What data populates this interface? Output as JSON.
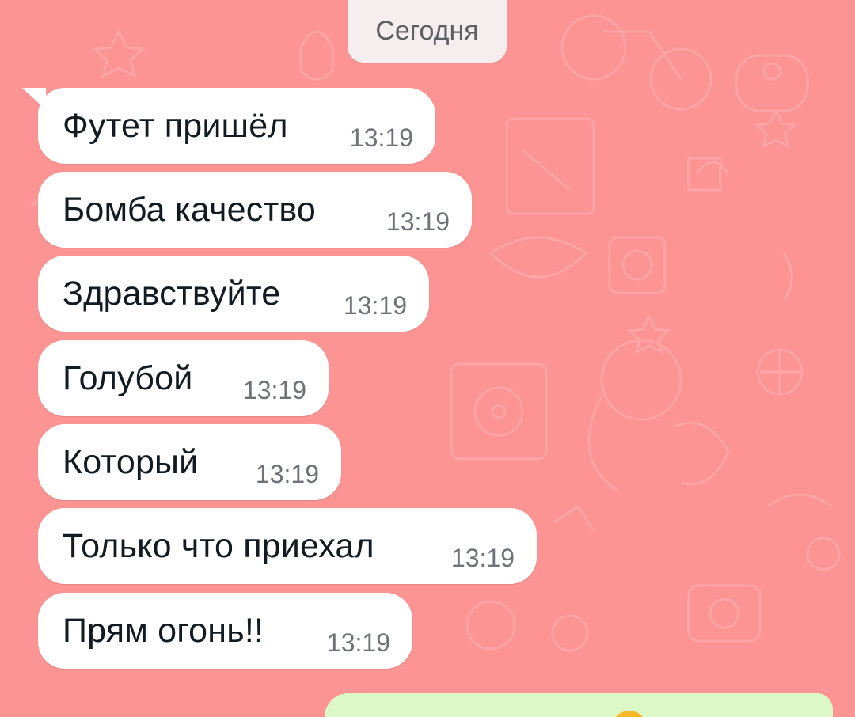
{
  "chat": {
    "date_separator": "Сегодня",
    "background_color": "#fc9494",
    "incoming_bubble_color": "#ffffff",
    "outgoing_bubble_color": "#dcf8c6",
    "messages": [
      {
        "text": "Футет пришёл",
        "time": "13:19",
        "direction": "incoming"
      },
      {
        "text": "Бомба качество",
        "time": "13:19",
        "direction": "incoming"
      },
      {
        "text": "Здравствуйте",
        "time": "13:19",
        "direction": "incoming"
      },
      {
        "text": "Голубой",
        "time": "13:19",
        "direction": "incoming"
      },
      {
        "text": "Который",
        "time": "13:19",
        "direction": "incoming"
      },
      {
        "text": "Только что приехал",
        "time": "13:19",
        "direction": "incoming"
      },
      {
        "text": "Прям огонь!!",
        "time": "13:19",
        "direction": "incoming"
      }
    ],
    "outgoing_partial": {
      "icon": "emoji-icon"
    }
  }
}
